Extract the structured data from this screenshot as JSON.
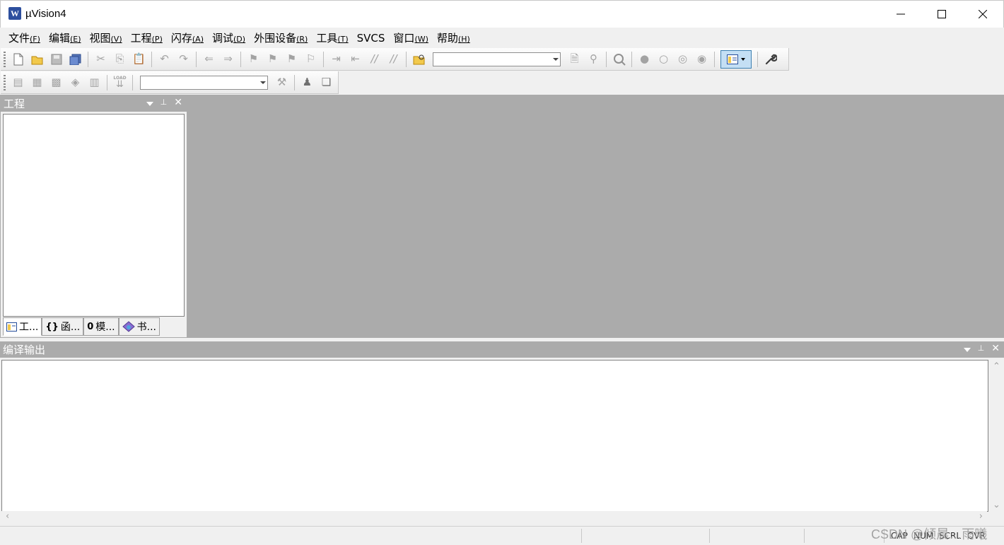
{
  "window": {
    "title": "µVision4",
    "app_icon_glyph": "W"
  },
  "menu": [
    {
      "label": "文件",
      "accel": "(F)"
    },
    {
      "label": "编辑",
      "accel": "(E)"
    },
    {
      "label": "视图",
      "accel": "(V)"
    },
    {
      "label": "工程",
      "accel": "(P)"
    },
    {
      "label": "闪存",
      "accel": "(A)"
    },
    {
      "label": "调试",
      "accel": "(D)"
    },
    {
      "label": "外围设备",
      "accel": "(R)"
    },
    {
      "label": "工具",
      "accel": "(T)"
    },
    {
      "label": "SVCS",
      "accel": ""
    },
    {
      "label": "窗口",
      "accel": "(W)"
    },
    {
      "label": "帮助",
      "accel": "(H)"
    }
  ],
  "toolbar1": {
    "find_combo_value": ""
  },
  "toolbar2": {
    "load_label": "LOAD",
    "target_combo_value": ""
  },
  "project_panel": {
    "title": "工程",
    "tabs": [
      {
        "icon": "project-tab-icon",
        "label": "工..."
      },
      {
        "icon": "functions-tab-icon",
        "glyph": "{}",
        "label": "函..."
      },
      {
        "icon": "templates-tab-icon",
        "glyph": "0",
        "label": "模..."
      },
      {
        "icon": "books-tab-icon",
        "label": "书..."
      }
    ]
  },
  "output_panel": {
    "title": "编译输出"
  },
  "statusbar": {
    "cap": "CAP",
    "num": "NUM",
    "scrl": "SCRL",
    "ovr": "OVR",
    "watermark": "CSDN @倾晨…雨曦"
  },
  "colors": {
    "panel_header": "#ababab",
    "workarea": "#ababab",
    "icon_disabled": "#a3a3a3",
    "toggle_active_bg": "#c4dff4",
    "toggle_active_border": "#3c7fb1"
  }
}
